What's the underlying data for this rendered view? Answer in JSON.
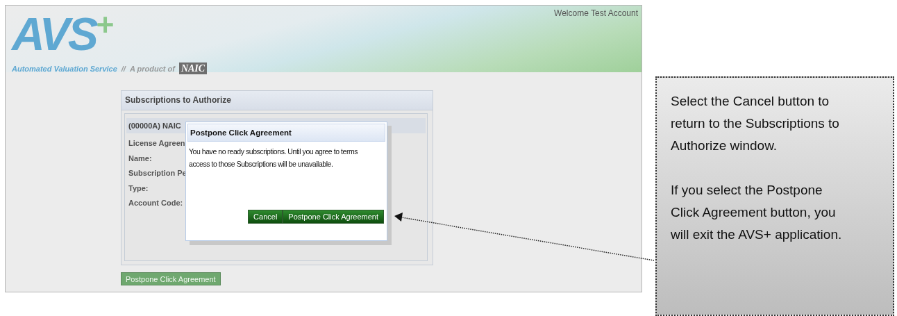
{
  "header": {
    "logo": "AVS",
    "logo_plus": "+",
    "tagline": "Automated Valuation Service",
    "separator": "//",
    "product_of": "A product of",
    "brand": "NAIC",
    "welcome": "Welcome Test Account"
  },
  "panel": {
    "title": "Subscriptions to Authorize",
    "section_title": "(00000A) NAIC",
    "fields": [
      "License Agreen",
      "Name:",
      "Subscription Pe",
      "Type:",
      "Account Code:"
    ],
    "button": "Postpone Click Agreement"
  },
  "dialog": {
    "title": "Postpone Click Agreement",
    "message": "You have no ready subscriptions. Until you agree to terms access to those Subscriptions will be unavailable.",
    "buttons": [
      "Cancel",
      "Postpone Click Agreement"
    ]
  },
  "callout": {
    "paragraphs": [
      "Select the Cancel button to return to the Subscriptions to Authorize window.",
      "If you select the Postpone Click Agreement button, you will exit the AVS+ application."
    ]
  }
}
